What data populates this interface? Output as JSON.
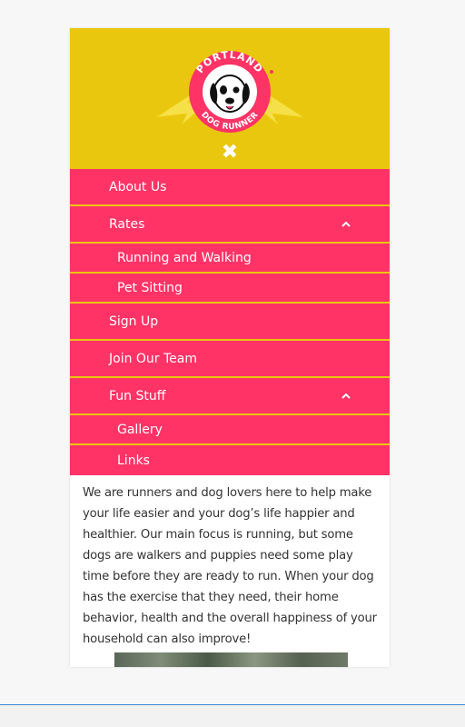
{
  "header": {
    "logo": {
      "top_text": "PORTLAND",
      "bottom_text": "DOG RUNNER",
      "icon": "dog-face-logo"
    },
    "close_icon": "close-icon",
    "colors": {
      "header_bg": "#e8c70e",
      "menu_bg": "#ff3366"
    }
  },
  "menu": {
    "about": "About Us",
    "rates": "Rates",
    "rates_sub": [
      "Running and Walking",
      "Pet Sitting"
    ],
    "signup": "Sign Up",
    "join": "Join Our Team",
    "fun": "Fun Stuff",
    "fun_sub": [
      "Gallery",
      "Links"
    ]
  },
  "content": {
    "paragraph": "We are runners and dog lovers here to help make your life easier and your dog’s life happier and healthier. Our main focus is running, but some dogs are walkers and puppies need some play time before they are ready to run.  When your dog has the exercise that they need, their home behavior, health and the overall happiness of your household can also improve!"
  }
}
